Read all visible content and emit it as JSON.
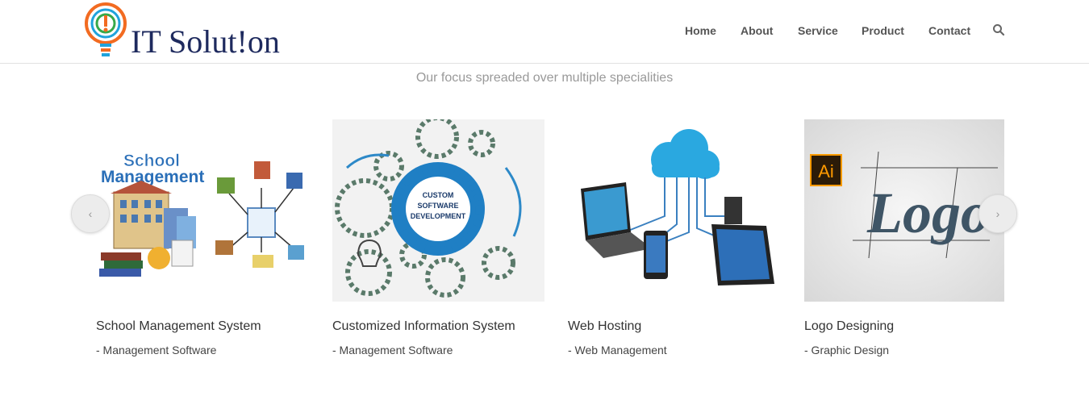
{
  "brand": {
    "name": "IT Solut!on",
    "colors": {
      "navy": "#1e2a5e",
      "orange": "#f26b21",
      "blue": "#1fa3dc",
      "green": "#37a94a"
    }
  },
  "nav": {
    "items": [
      "Home",
      "About",
      "Service",
      "Product",
      "Contact"
    ],
    "search_icon": "search-icon"
  },
  "tagline": "Our focus spreaded over multiple specialities",
  "image_text": {
    "school_1": "School",
    "school_2": "Management",
    "custom_1": "CUSTOM",
    "custom_2": "SOFTWARE",
    "custom_3": "DEVELOPMENT",
    "ai": "Ai",
    "logo": "Logo"
  },
  "cards": [
    {
      "title": "School Management System",
      "subtitle": "- Management Software",
      "icon": "school-management-illustration"
    },
    {
      "title": "Customized Information System",
      "subtitle": "- Management Software",
      "icon": "custom-software-gears-illustration"
    },
    {
      "title": "Web Hosting",
      "subtitle": "- Web Management",
      "icon": "cloud-devices-illustration"
    },
    {
      "title": "Logo Designing",
      "subtitle": "- Graphic Design",
      "icon": "ai-logo-illustration"
    }
  ],
  "carousel": {
    "prev_label": "‹",
    "next_label": "›"
  }
}
